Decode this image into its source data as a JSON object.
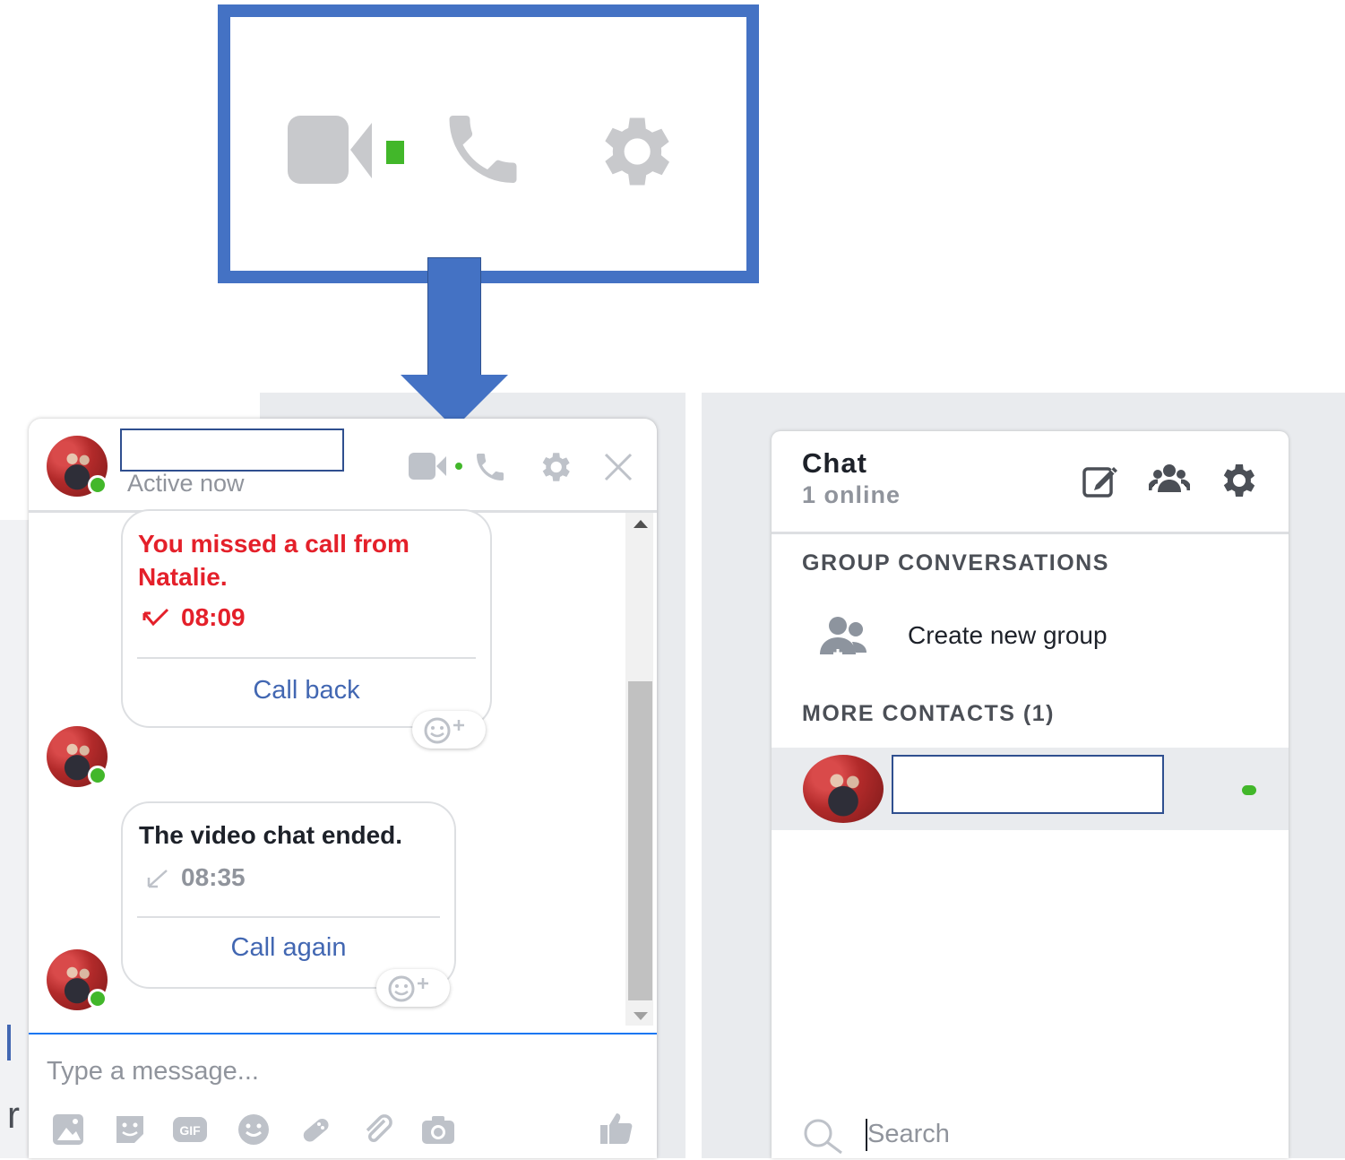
{
  "chat_window": {
    "status": "Active now",
    "messages": [
      {
        "text": "You missed a call from Natalie.",
        "line1": "You missed a call from",
        "line2": "Natalie.",
        "time": "08:09",
        "action": "Call back"
      },
      {
        "text": "The video chat ended.",
        "time": "08:35",
        "action": "Call again"
      }
    ],
    "composer_placeholder": "Type a message..."
  },
  "sidebar": {
    "title": "Chat",
    "subtitle": "1 online",
    "group_section": "GROUP CONVERSATIONS",
    "create_group": "Create new group",
    "contacts_section": "MORE CONTACTS (1)",
    "search_placeholder": "Search"
  },
  "colors": {
    "callout_border": "#4472c4",
    "missed_red": "#e4202a",
    "link_blue": "#4267b2",
    "online_green": "#42b72a"
  }
}
